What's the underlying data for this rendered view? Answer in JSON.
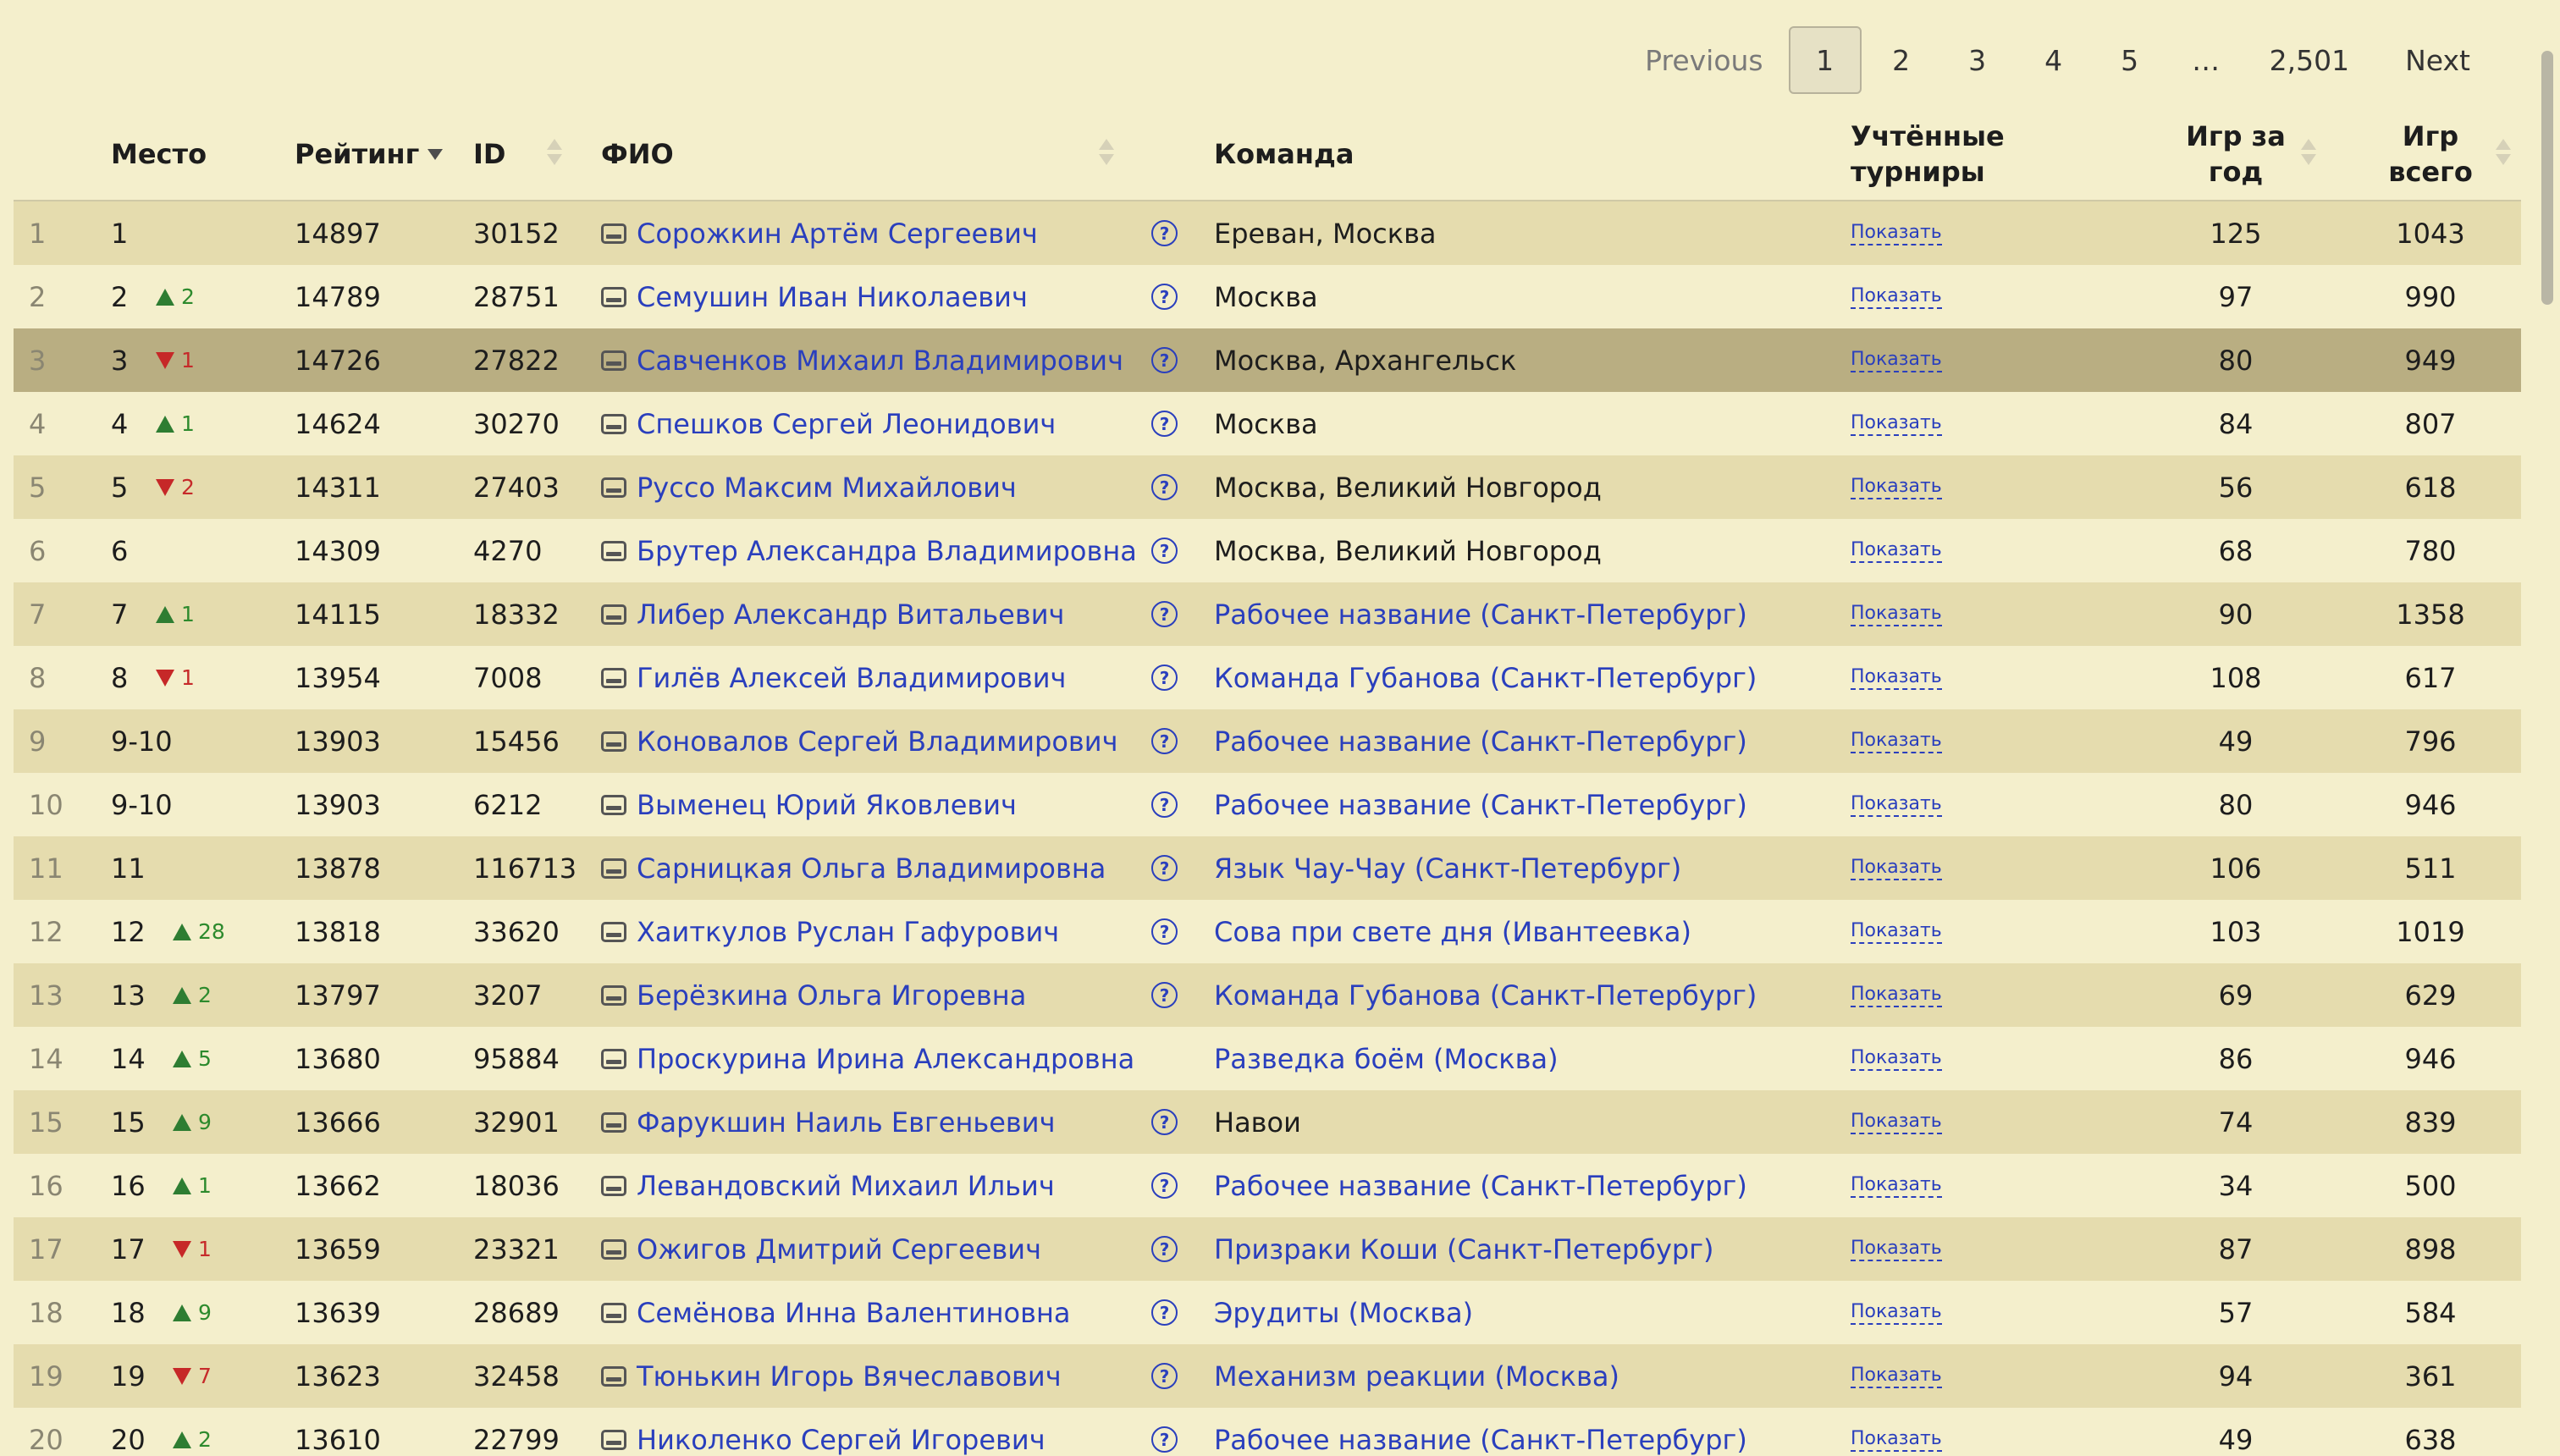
{
  "pagination": {
    "previous": "Previous",
    "pages": [
      "1",
      "2",
      "3",
      "4",
      "5"
    ],
    "active": "1",
    "ellipsis": "…",
    "last": "2,501",
    "next": "Next"
  },
  "columns": {
    "place": "Место",
    "rating": "Рейтинг",
    "id": "ID",
    "name": "ФИО",
    "team": "Команда",
    "tournaments_line1": "Учтённые",
    "tournaments_line2": "турниры",
    "year_line1": "Игр за",
    "year_line2": "год",
    "total_line1": "Игр",
    "total_line2": "всего"
  },
  "show_label": "Показать",
  "help_symbol": "?",
  "rows": [
    {
      "idx": "1",
      "place": "1",
      "dir": "",
      "delta": "",
      "rating": "14897",
      "id": "30152",
      "name": "Сорожкин Артём Сергеевич",
      "help": true,
      "team": "Ереван, Москва",
      "team_link": false,
      "year": "125",
      "total": "1043"
    },
    {
      "idx": "2",
      "place": "2",
      "dir": "up",
      "delta": "2",
      "rating": "14789",
      "id": "28751",
      "name": "Семушин Иван Николаевич",
      "help": true,
      "team": "Москва",
      "team_link": false,
      "year": "97",
      "total": "990"
    },
    {
      "idx": "3",
      "place": "3",
      "dir": "down",
      "delta": "1",
      "rating": "14726",
      "id": "27822",
      "name": "Савченков Михаил Владимирович",
      "help": true,
      "team": "Москва, Архангельск",
      "team_link": false,
      "year": "80",
      "total": "949"
    },
    {
      "idx": "4",
      "place": "4",
      "dir": "up",
      "delta": "1",
      "rating": "14624",
      "id": "30270",
      "name": "Спешков Сергей Леонидович",
      "help": true,
      "team": "Москва",
      "team_link": false,
      "year": "84",
      "total": "807"
    },
    {
      "idx": "5",
      "place": "5",
      "dir": "down",
      "delta": "2",
      "rating": "14311",
      "id": "27403",
      "name": "Руссо Максим Михайлович",
      "help": true,
      "team": "Москва, Великий Новгород",
      "team_link": false,
      "year": "56",
      "total": "618"
    },
    {
      "idx": "6",
      "place": "6",
      "dir": "",
      "delta": "",
      "rating": "14309",
      "id": "4270",
      "name": "Брутер Александра Владимировна",
      "help": true,
      "team": "Москва, Великий Новгород",
      "team_link": false,
      "year": "68",
      "total": "780"
    },
    {
      "idx": "7",
      "place": "7",
      "dir": "up",
      "delta": "1",
      "rating": "14115",
      "id": "18332",
      "name": "Либер Александр Витальевич",
      "help": true,
      "team": "Рабочее название (Санкт-Петербург)",
      "team_link": true,
      "year": "90",
      "total": "1358"
    },
    {
      "idx": "8",
      "place": "8",
      "dir": "down",
      "delta": "1",
      "rating": "13954",
      "id": "7008",
      "name": "Гилёв Алексей Владимирович",
      "help": true,
      "team": "Команда Губанова (Санкт-Петербург)",
      "team_link": true,
      "year": "108",
      "total": "617"
    },
    {
      "idx": "9",
      "place": "9-10",
      "dir": "",
      "delta": "",
      "rating": "13903",
      "id": "15456",
      "name": "Коновалов Сергей Владимирович",
      "help": true,
      "team": "Рабочее название (Санкт-Петербург)",
      "team_link": true,
      "year": "49",
      "total": "796"
    },
    {
      "idx": "10",
      "place": "9-10",
      "dir": "",
      "delta": "",
      "rating": "13903",
      "id": "6212",
      "name": "Выменец Юрий Яковлевич",
      "help": true,
      "team": "Рабочее название (Санкт-Петербург)",
      "team_link": true,
      "year": "80",
      "total": "946"
    },
    {
      "idx": "11",
      "place": "11",
      "dir": "",
      "delta": "",
      "rating": "13878",
      "id": "116713",
      "name": "Сарницкая Ольга Владимировна",
      "help": true,
      "team": "Язык Чау-Чау (Санкт-Петербург)",
      "team_link": true,
      "year": "106",
      "total": "511"
    },
    {
      "idx": "12",
      "place": "12",
      "dir": "up",
      "delta": "28",
      "rating": "13818",
      "id": "33620",
      "name": "Хаиткулов Руслан Гафурович",
      "help": true,
      "team": "Сова при свете дня (Ивантеевка)",
      "team_link": true,
      "year": "103",
      "total": "1019"
    },
    {
      "idx": "13",
      "place": "13",
      "dir": "up",
      "delta": "2",
      "rating": "13797",
      "id": "3207",
      "name": "Берёзкина Ольга Игоревна",
      "help": true,
      "team": "Команда Губанова (Санкт-Петербург)",
      "team_link": true,
      "year": "69",
      "total": "629"
    },
    {
      "idx": "14",
      "place": "14",
      "dir": "up",
      "delta": "5",
      "rating": "13680",
      "id": "95884",
      "name": "Проскурина Ирина Александровна",
      "help": false,
      "team": "Разведка боём (Москва)",
      "team_link": true,
      "year": "86",
      "total": "946"
    },
    {
      "idx": "15",
      "place": "15",
      "dir": "up",
      "delta": "9",
      "rating": "13666",
      "id": "32901",
      "name": "Фарукшин Наиль Евгеньевич",
      "help": true,
      "team": "Навои",
      "team_link": false,
      "year": "74",
      "total": "839"
    },
    {
      "idx": "16",
      "place": "16",
      "dir": "up",
      "delta": "1",
      "rating": "13662",
      "id": "18036",
      "name": "Левандовский Михаил Ильич",
      "help": true,
      "team": "Рабочее название (Санкт-Петербург)",
      "team_link": true,
      "year": "34",
      "total": "500"
    },
    {
      "idx": "17",
      "place": "17",
      "dir": "down",
      "delta": "1",
      "rating": "13659",
      "id": "23321",
      "name": "Ожигов Дмитрий Сергеевич",
      "help": true,
      "team": "Призраки Коши (Санкт-Петербург)",
      "team_link": true,
      "year": "87",
      "total": "898"
    },
    {
      "idx": "18",
      "place": "18",
      "dir": "up",
      "delta": "9",
      "rating": "13639",
      "id": "28689",
      "name": "Семёнова Инна Валентиновна",
      "help": true,
      "team": "Эрудиты (Москва)",
      "team_link": true,
      "year": "57",
      "total": "584"
    },
    {
      "idx": "19",
      "place": "19",
      "dir": "down",
      "delta": "7",
      "rating": "13623",
      "id": "32458",
      "name": "Тюнькин Игорь Вячеславович",
      "help": true,
      "team": "Механизм реакции (Москва)",
      "team_link": true,
      "year": "94",
      "total": "361"
    },
    {
      "idx": "20",
      "place": "20",
      "dir": "up",
      "delta": "2",
      "rating": "13610",
      "id": "22799",
      "name": "Николенко Сергей Игоревич",
      "help": true,
      "team": "Рабочее название (Санкт-Петербург)",
      "team_link": true,
      "year": "49",
      "total": "638"
    }
  ],
  "highlighted_row": "3"
}
